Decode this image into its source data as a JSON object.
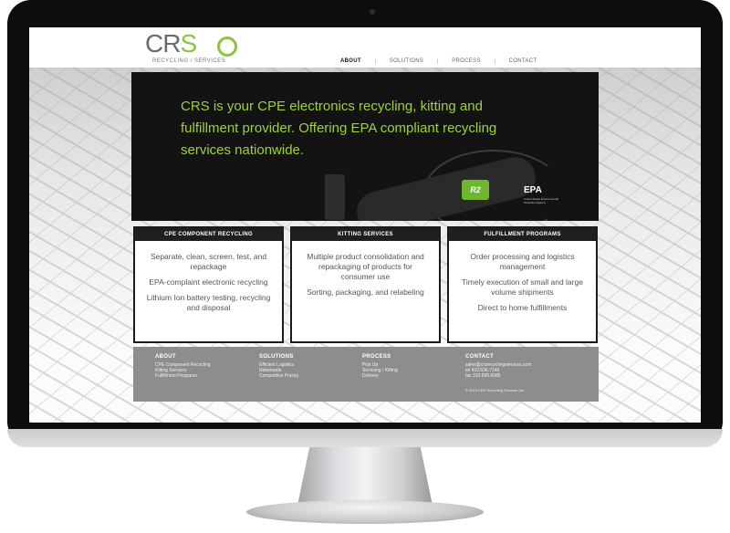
{
  "logo": {
    "mark_left": "CR",
    "mark_right": "S",
    "subtitle": "RECYCLING / SERVICES"
  },
  "nav": {
    "items": [
      "ABOUT",
      "SOLUTIONS",
      "PROCESS",
      "CONTACT"
    ],
    "active": "ABOUT"
  },
  "hero": {
    "headline": "CRS is your CPE electronics recycling, kitting and fulfillment provider. Offering EPA compliant recycling services nationwide.",
    "badge_r2": "R2",
    "badge_epa": "EPA",
    "badge_epa_sub": "United States Environmental Protection Agency"
  },
  "cards": [
    {
      "title": "CPE COMPONENT RECYCLING",
      "lines": [
        "Separate, clean, screen, test, and repackage",
        "EPA-complaint electronic recycling",
        "Lithium Ion battery testing, recycling and disposal"
      ]
    },
    {
      "title": "KITTING SERVICES",
      "lines": [
        "Multiple product consolidation and repackaging of products for consumer use",
        "Sorting, packaging, and relabeling"
      ]
    },
    {
      "title": "FULFILLMENT PROGRAMS",
      "lines": [
        "Order processing and logistics management",
        "Timely execution of small and large volume shipments",
        "Direct to home fulfillments"
      ]
    }
  ],
  "footer": {
    "about": {
      "heading": "ABOUT",
      "links": [
        "CPE Component Recycling",
        "Kitting Services",
        "Fulfillment Programs"
      ]
    },
    "solutions": {
      "heading": "SOLUTIONS",
      "links": [
        "Efficient Logistics",
        "Nationwide",
        "Competitive Pricing"
      ]
    },
    "process": {
      "heading": "PROCESS",
      "links": [
        "Pick Up",
        "Servicing / Kitting",
        "Delivery"
      ]
    },
    "contact": {
      "heading": "CONTACT",
      "email": "sales@crsrecyclingservices.com",
      "tel": "tel  410.536.7146",
      "fax": "fax  310.895.6085"
    },
    "copyright": "© 2015 CRS Recycling Services Inc."
  },
  "colors": {
    "accent": "#8bc43f",
    "hero_text": "#9bd23d",
    "card_header": "#1f1f1f",
    "footer": "#8d8d8d"
  }
}
